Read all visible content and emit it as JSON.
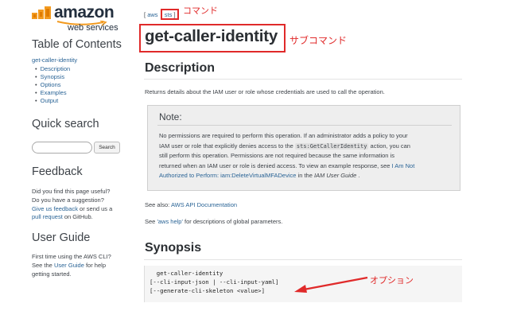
{
  "logo": {
    "word": "amazon",
    "sub": "web services"
  },
  "sidebar": {
    "toc_title": "Table of Contents",
    "toc_root": "get-caller-identity",
    "toc_items": [
      "Description",
      "Synopsis",
      "Options",
      "Examples",
      "Output"
    ],
    "quick_search_title": "Quick search",
    "search_button": "Search",
    "feedback_title": "Feedback",
    "feedback": {
      "line1": "Did you find this page useful?",
      "line2": "Do you have a suggestion?",
      "link1": "Give us feedback",
      "mid": " or send us a",
      "link2": "pull request",
      "tail": " on GitHub."
    },
    "user_guide_title": "User Guide",
    "user_guide": {
      "line1": "First time using the AWS CLI?",
      "pre": "See the ",
      "link": "User Guide",
      "post": " for help",
      "line3": "getting started."
    }
  },
  "breadcrumb": {
    "open": "[",
    "aws": "aws",
    "sep": " . ",
    "sts": "sts",
    "close": "]"
  },
  "annotations": {
    "command": "コマンド",
    "subcommand": "サブコマンド",
    "option": "オプション"
  },
  "page_title": "get-caller-identity",
  "description": {
    "heading": "Description",
    "text": "Returns details about the IAM user or role whose credentials are used to call the operation."
  },
  "note": {
    "title": "Note:",
    "t1": "No permissions are required to perform this operation. If an administrator adds a policy to your",
    "t2": "IAM user or role that explicitly denies access to the ",
    "code": "sts:GetCallerIdentity",
    "t3": " action, you can",
    "t4": "still perform this operation. Permissions are not required because the same information is",
    "t5": "returned when an IAM user or role is denied access. To view an example response, see ",
    "link1": "I Am Not",
    "link2": "Authorized to Perform: iam:DeleteVirtualMFADevice",
    "t6": " in the ",
    "guide": "IAM User Guide",
    "t7": " ."
  },
  "see_also": {
    "pre": "See also: ",
    "link": "AWS API Documentation"
  },
  "see_help": {
    "pre": "See ",
    "link": "'aws help'",
    "post": " for descriptions of global parameters."
  },
  "synopsis": {
    "heading": "Synopsis",
    "lines": [
      "  get-caller-identity",
      "[--cli-input-json | --cli-input-yaml]",
      "[--generate-cli-skeleton <value>]"
    ]
  },
  "colors": {
    "annotation": "#e02a2a",
    "link": "#2a6496",
    "aws_orange": "#f29a1f"
  }
}
